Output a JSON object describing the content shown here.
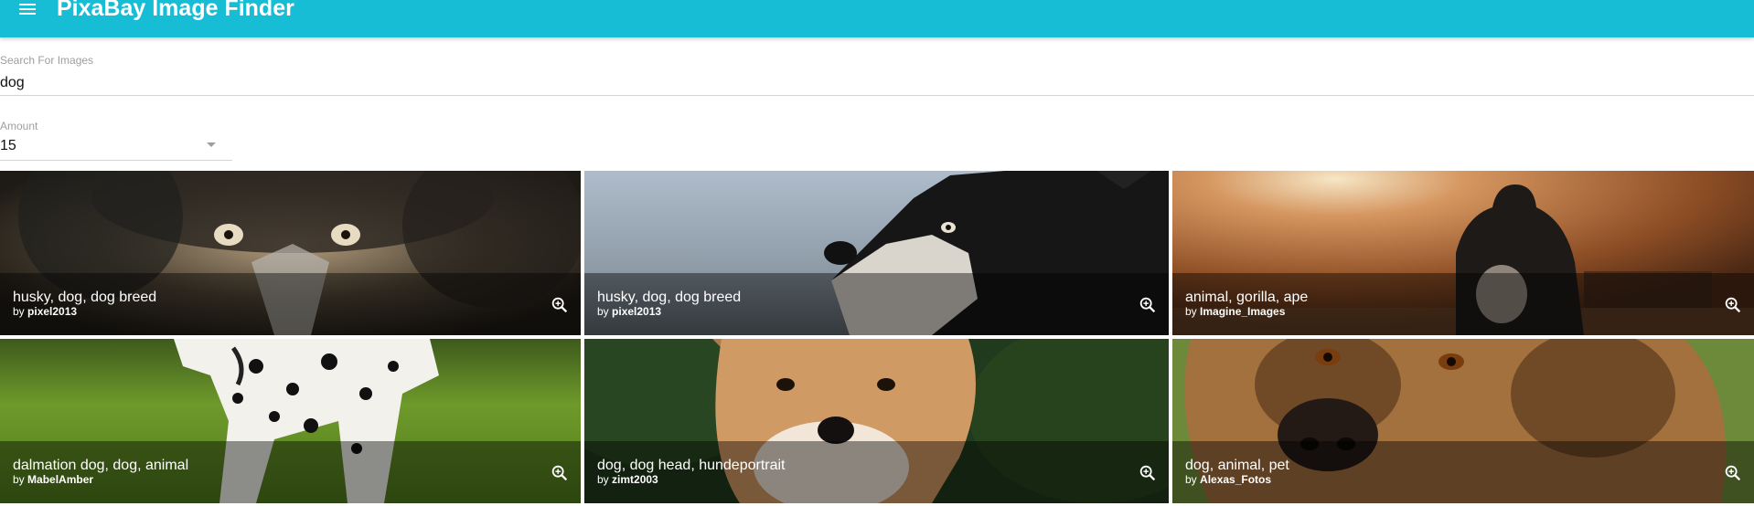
{
  "appbar": {
    "title": "PixaBay Image Finder",
    "menu_icon": "menu-icon",
    "color": "#17bcd5"
  },
  "search": {
    "label": "Search For Images",
    "value": "dog"
  },
  "amount": {
    "label": "Amount",
    "value": "15"
  },
  "images": [
    {
      "title": "husky, dog, dog breed",
      "by_prefix": "by",
      "author": "pixel2013"
    },
    {
      "title": "husky, dog, dog breed",
      "by_prefix": "by",
      "author": "pixel2013"
    },
    {
      "title": "animal, gorilla, ape",
      "by_prefix": "by",
      "author": "Imagine_Images"
    },
    {
      "title": "dalmation dog, dog, animal",
      "by_prefix": "by",
      "author": "MabelAmber"
    },
    {
      "title": "dog, dog head, hundeportrait",
      "by_prefix": "by",
      "author": "zimt2003"
    },
    {
      "title": "dog, animal, pet",
      "by_prefix": "by",
      "author": "Alexas_Fotos"
    }
  ],
  "zoom_icon": "zoom-in-icon"
}
